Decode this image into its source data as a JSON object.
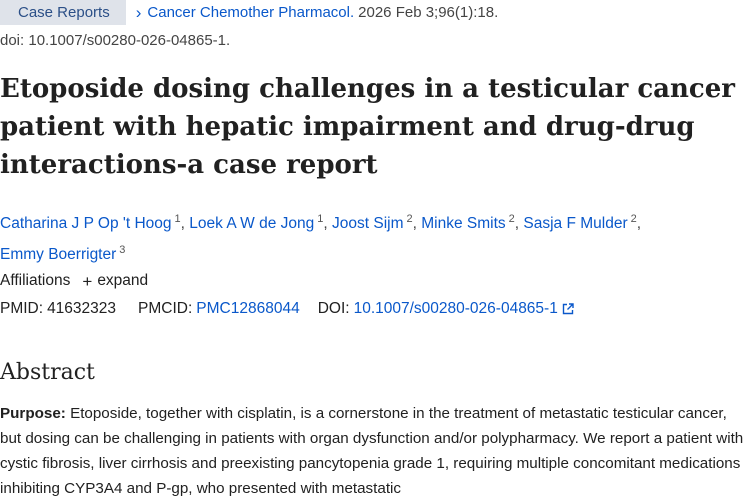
{
  "topline": {
    "badge": "Case Reports",
    "journal": "Cancer Chemother Pharmacol.",
    "citation": "2026 Feb 3;96(1):18."
  },
  "doi_line": "doi: 10.1007/s00280-026-04865-1.",
  "title": "Etoposide dosing challenges in a testicular cancer patient with hepatic impairment and drug-drug interactions-a case report",
  "authors": [
    {
      "name": "Catharina J P Op 't Hoog",
      "sup": "1"
    },
    {
      "name": "Loek A W de Jong",
      "sup": "1"
    },
    {
      "name": "Joost Sijm",
      "sup": "2"
    },
    {
      "name": "Minke Smits",
      "sup": "2"
    },
    {
      "name": "Sasja F Mulder",
      "sup": "2"
    },
    {
      "name": "Emmy Boerrigter",
      "sup": "3"
    }
  ],
  "affiliations": {
    "label": "Affiliations",
    "toggle": "expand"
  },
  "ids": {
    "pmid_label": "PMID:",
    "pmid": "41632323",
    "pmcid_label": "PMCID:",
    "pmcid": "PMC12868044",
    "doi_label": "DOI:",
    "doi": "10.1007/s00280-026-04865-1"
  },
  "abstract": {
    "heading": "Abstract",
    "purpose_label": "Purpose:",
    "purpose_text": "Etoposide, together with cisplatin, is a cornerstone in the treatment of metastatic testicular cancer, but dosing can be challenging in patients with organ dysfunction and/or polypharmacy. We report a patient with cystic fibrosis, liver cirrhosis and preexisting pancytopenia grade 1, requiring multiple concomitant medications inhibiting CYP3A4 and P-gp, who presented with metastatic"
  },
  "icons": {
    "chevron": "chevron-right-icon",
    "plus": "plus-icon",
    "external": "external-link-icon"
  },
  "colors": {
    "link": "#0a58ca",
    "badge_bg": "#dfe3ea",
    "badge_text": "#2b4f87",
    "text": "#212121"
  }
}
